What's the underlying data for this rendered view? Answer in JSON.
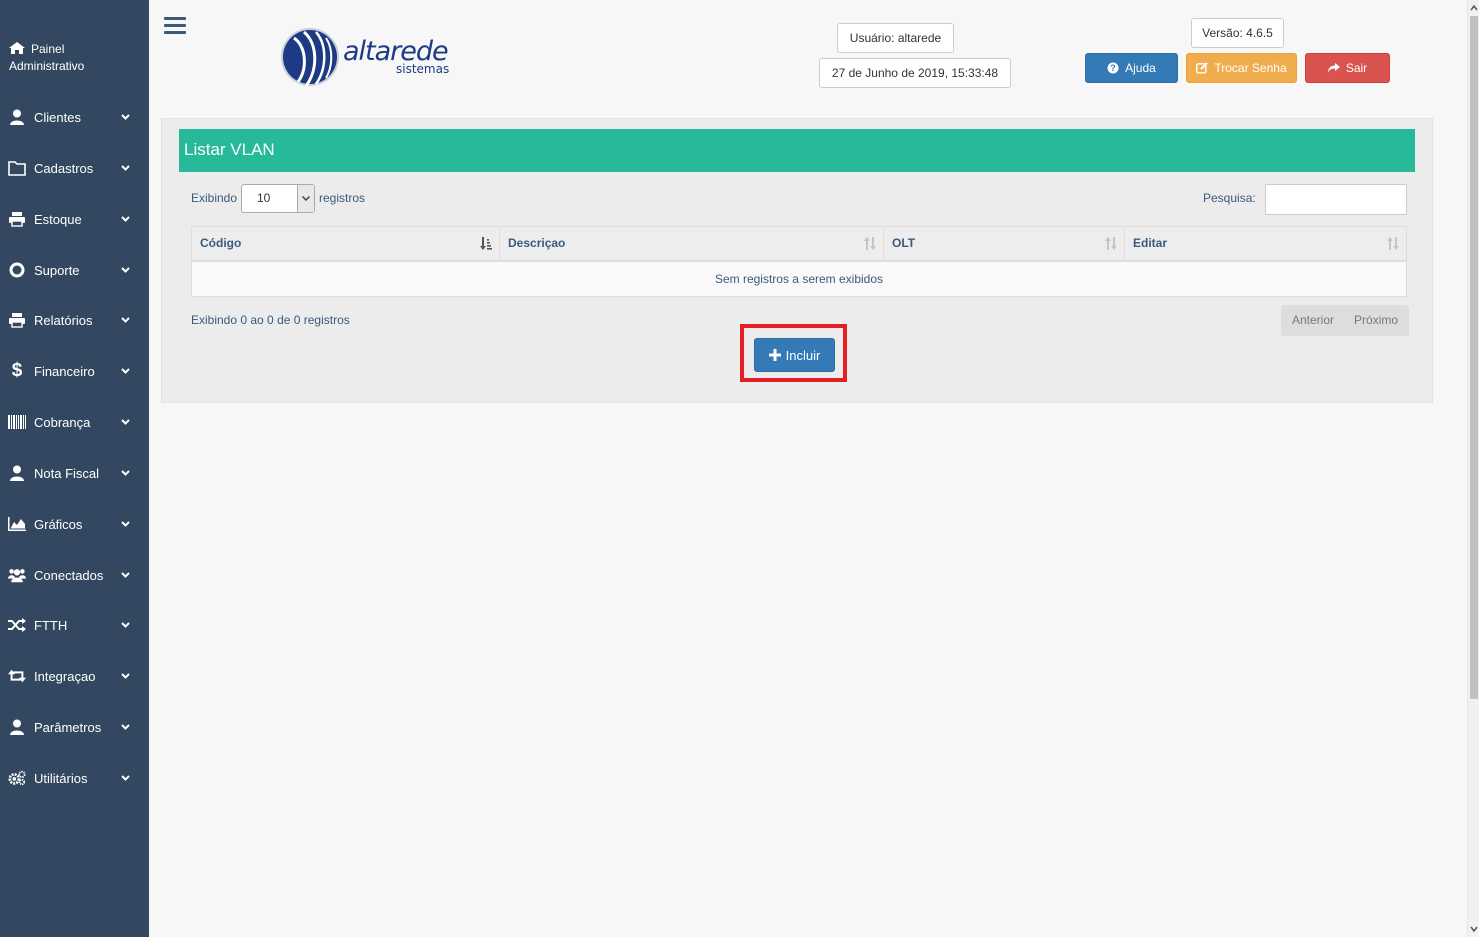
{
  "sidebar": {
    "brand": "Painel Administrativo",
    "items": [
      {
        "label": "Clientes",
        "icon": "user-icon"
      },
      {
        "label": "Cadastros",
        "icon": "folder-icon"
      },
      {
        "label": "Estoque",
        "icon": "print-icon"
      },
      {
        "label": "Suporte",
        "icon": "lifebuoy-icon"
      },
      {
        "label": "Relatórios",
        "icon": "print-icon"
      },
      {
        "label": "Financeiro",
        "icon": "dollar-icon"
      },
      {
        "label": "Cobrança",
        "icon": "barcode-icon"
      },
      {
        "label": "Nota Fiscal",
        "icon": "user-icon"
      },
      {
        "label": "Gráficos",
        "icon": "area-chart-icon"
      },
      {
        "label": "Conectados",
        "icon": "users-icon"
      },
      {
        "label": "FTTH",
        "icon": "random-icon"
      },
      {
        "label": "Integraçao",
        "icon": "retweet-icon"
      },
      {
        "label": "Parâmetros",
        "icon": "user-icon"
      },
      {
        "label": "Utilitários",
        "icon": "gears-icon"
      }
    ]
  },
  "header": {
    "logo_text": "altarede",
    "logo_sub": "sistemas",
    "user": "Usuário: altarede",
    "datetime": "27 de Junho de 2019, 15:33:48",
    "version": "Versão: 4.6.5",
    "help_label": "Ajuda",
    "change_password_label": "Trocar Senha",
    "exit_label": "Sair"
  },
  "panel": {
    "title": "Listar VLAN",
    "length_prefix": "Exibindo",
    "length_value": "10",
    "length_suffix": "registros",
    "search_label": "Pesquisa:",
    "search_value": "",
    "columns": [
      "Código",
      "Descriçao",
      "OLT",
      "Editar"
    ],
    "empty_message": "Sem registros a serem exibidos",
    "info": "Exibindo 0 ao 0 de 0 registros",
    "prev_label": "Anterior",
    "next_label": "Próximo",
    "add_label": "Incluir"
  },
  "colors": {
    "sidebar_bg": "#334860",
    "title_bar": "#26b99a",
    "primary": "#337ab7",
    "warning": "#f0ad4e",
    "danger": "#d9534f",
    "highlight": "#e31e24"
  }
}
